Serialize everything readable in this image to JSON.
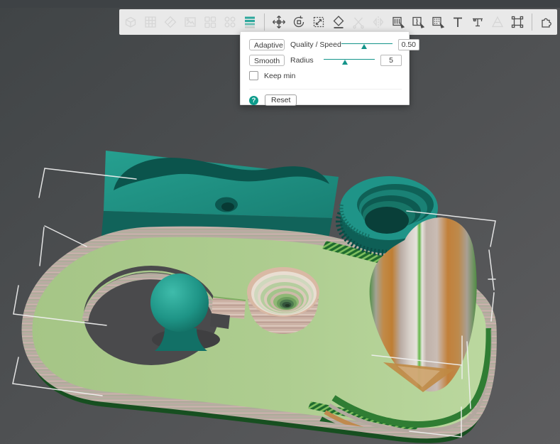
{
  "window": {
    "top_strip_color": "#3e4245",
    "viewport_bg_from": "#404446",
    "viewport_bg_to": "#5d5d5f"
  },
  "toolbar": {
    "background": "#e9e9e9",
    "icon_color": "#4e4e4e",
    "disabled_icon_color": "#d6d6d6",
    "active_accent": "#2ba79c",
    "items": [
      {
        "name": "add-part",
        "enabled": false
      },
      {
        "name": "delete-grid",
        "enabled": false
      },
      {
        "name": "edit-part",
        "enabled": false
      },
      {
        "name": "image",
        "enabled": false
      },
      {
        "name": "arrange",
        "enabled": false
      },
      {
        "name": "duplicate",
        "enabled": false
      },
      {
        "name": "variable-layer-height",
        "enabled": true,
        "active": true
      },
      {
        "name": "move",
        "enabled": true
      },
      {
        "name": "rotate",
        "enabled": true
      },
      {
        "name": "scale",
        "enabled": true
      },
      {
        "name": "place-on-face",
        "enabled": true
      },
      {
        "name": "cut",
        "enabled": false
      },
      {
        "name": "mirror",
        "enabled": false
      },
      {
        "name": "paint-support",
        "enabled": true
      },
      {
        "name": "seam-paint",
        "enabled": true
      },
      {
        "name": "fuzzy-skin-paint",
        "enabled": true
      },
      {
        "name": "text",
        "enabled": true
      },
      {
        "name": "measure",
        "enabled": true
      },
      {
        "name": "simplify",
        "enabled": false
      },
      {
        "name": "transform",
        "enabled": true
      },
      {
        "name": "plugin",
        "enabled": true
      }
    ]
  },
  "layer_height_panel": {
    "accent": "#14948a",
    "mode_button": "Adaptive",
    "quality_label": "Quality / Speed",
    "quality_value": "0.50",
    "quality_slider_pos": 0.45,
    "smooth_button": "Smooth",
    "radius_label": "Radius",
    "radius_value": "5",
    "radius_slider_pos": 0.43,
    "keep_min_label": "Keep min",
    "keep_min_checked": false,
    "help_symbol": "?",
    "reset_label": "Reset"
  },
  "scene": {
    "model_teal": "#1f9488",
    "model_teal_dark": "#11635a",
    "plate_green": "#adcb8f",
    "layer_band_pink": "#c0aba4",
    "edge_dark_green": "#1d6b2e",
    "wedge_orange": "#c07f38",
    "wedge_center_green": "#62b648",
    "dimension_line_color": "#f0f0f0"
  }
}
